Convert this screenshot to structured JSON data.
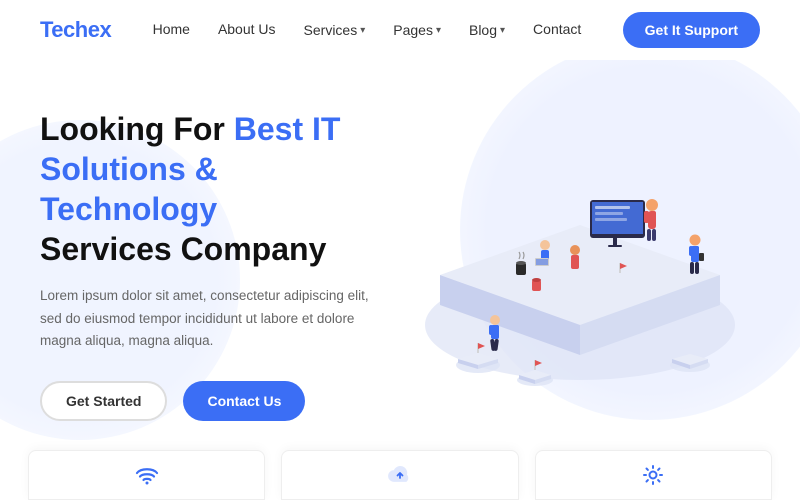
{
  "logo": {
    "text_black": "Tech",
    "text_blue": "ex"
  },
  "navbar": {
    "links": [
      {
        "label": "Home",
        "has_dropdown": false
      },
      {
        "label": "About Us",
        "has_dropdown": false
      },
      {
        "label": "Services",
        "has_dropdown": true
      },
      {
        "label": "Pages",
        "has_dropdown": true
      },
      {
        "label": "Blog",
        "has_dropdown": true
      },
      {
        "label": "Contact",
        "has_dropdown": false
      }
    ],
    "cta_label": "Get It Support"
  },
  "hero": {
    "title_line1": "Looking For ",
    "title_highlight": "Best IT",
    "title_line2": "Solutions & Technology",
    "title_line3": "Services Company",
    "description": "Lorem ipsum dolor sit amet, consectetur adipiscing elit, sed do eiusmod tempor incididunt ut labore et dolore magna aliqua, magna aliqua.",
    "btn_outline": "Get Started",
    "btn_primary": "Contact Us"
  },
  "bottom_cards": [
    {
      "id": "card-1",
      "icon_name": "wifi-icon"
    },
    {
      "id": "card-2",
      "icon_name": "cloud-icon"
    },
    {
      "id": "card-3",
      "icon_name": "settings-icon"
    }
  ],
  "colors": {
    "accent": "#3b6ef5",
    "text_dark": "#111111",
    "text_muted": "#666666"
  }
}
